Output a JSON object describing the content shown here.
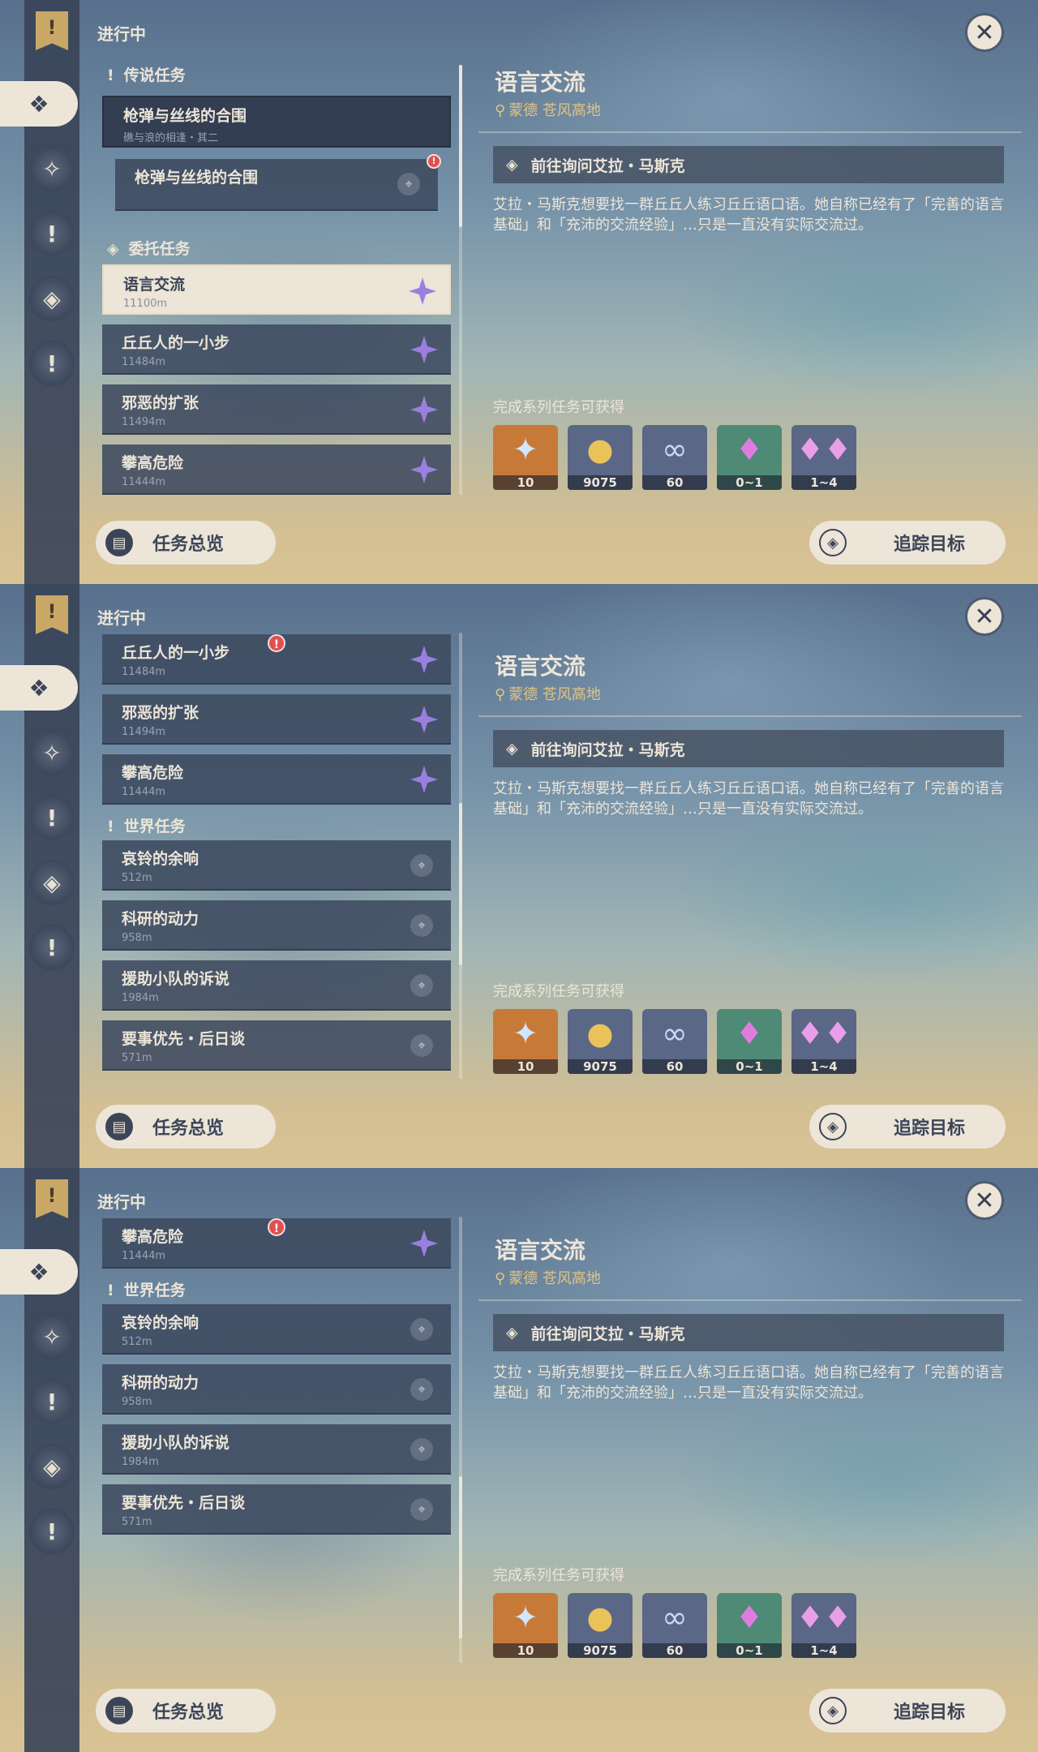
{
  "common": {
    "status": "进行中",
    "quest_title": "语言交流",
    "location": "蒙德 苍风高地",
    "objective": "前往询问艾拉・马斯克",
    "description": "艾拉・马斯克想要找一群丘丘人练习丘丘语口语。她自称已经有了「完善的语言基础」和「充沛的交流经验」…只是一直没有实际交流过。",
    "rewards_label": "完成系列任务可获得",
    "rewards": [
      {
        "icon": "primogem-icon",
        "count": "10",
        "bg": "#c77a38"
      },
      {
        "icon": "mora-icon",
        "count": "9075",
        "bg": "#5a6787"
      },
      {
        "icon": "companionship-exp-icon",
        "count": "60",
        "bg": "#5a6787"
      },
      {
        "icon": "crystal-ore-icon",
        "count": "0~1",
        "bg": "#4f8a77"
      },
      {
        "icon": "crystal-chunk-icon",
        "count": "1~4",
        "bg": "#5a6787"
      }
    ],
    "overview_button": "任务总览",
    "track_button": "追踪目标",
    "close_icon": "close-icon"
  },
  "panel1": {
    "legend_header": "传说任务",
    "legend_title": "枪弹与丝线的合围",
    "legend_subtitle": "礁与浪的相逢・其二",
    "legend_sub_item": "枪弹与丝线的合围",
    "commission_header": "委托任务",
    "items": [
      {
        "name": "语言交流",
        "dist": "11100m"
      },
      {
        "name": "丘丘人的一小步",
        "dist": "11484m"
      },
      {
        "name": "邪恶的扩张",
        "dist": "11494m"
      },
      {
        "name": "攀高危险",
        "dist": "11444m"
      }
    ]
  },
  "panel2": {
    "commission_items": [
      {
        "name": "丘丘人的一小步",
        "dist": "11484m"
      },
      {
        "name": "邪恶的扩张",
        "dist": "11494m"
      },
      {
        "name": "攀高危险",
        "dist": "11444m"
      }
    ],
    "world_header": "世界任务",
    "world_items": [
      {
        "name": "哀铃的余响",
        "dist": "512m"
      },
      {
        "name": "科研的动力",
        "dist": "958m"
      },
      {
        "name": "援助小队的诉说",
        "dist": "1984m"
      },
      {
        "name": "要事优先・后日谈",
        "dist": "571m"
      }
    ]
  },
  "panel3": {
    "commission_item": {
      "name": "攀高危险",
      "dist": "11444m"
    },
    "world_header": "世界任务",
    "world_items": [
      {
        "name": "哀铃的余响",
        "dist": "512m"
      },
      {
        "name": "科研的动力",
        "dist": "958m"
      },
      {
        "name": "援助小队的诉说",
        "dist": "1984m"
      },
      {
        "name": "要事优先・后日谈",
        "dist": "571m"
      }
    ]
  }
}
